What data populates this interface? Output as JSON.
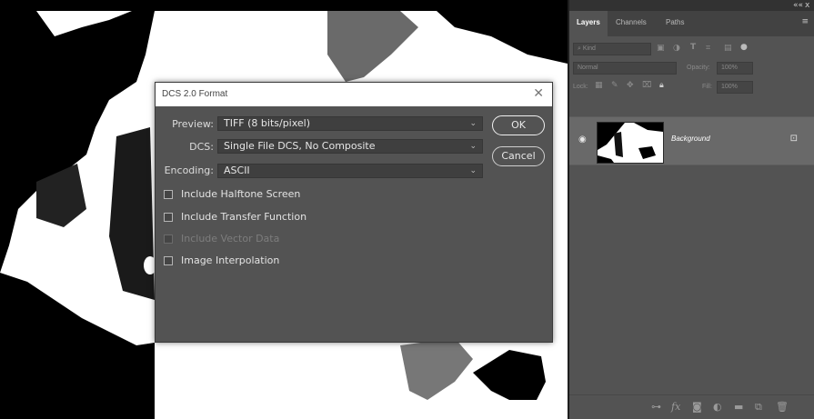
{
  "panel": {
    "top_controls": {
      "collapse": "««",
      "close": "x"
    },
    "tabs": [
      {
        "label": "Layers"
      },
      {
        "label": "Channels"
      },
      {
        "label": "Paths"
      }
    ],
    "menu_icon": "panel-menu-icon",
    "kind_filter": {
      "value": "Kind"
    },
    "blend_mode": {
      "value": "Normal"
    },
    "opacity": {
      "label": "Opacity:",
      "value": "100%"
    },
    "lock": {
      "label": "Lock:"
    },
    "fill": {
      "label": "Fill:",
      "value": "100%"
    },
    "layer": {
      "name": "Background",
      "visible_icon": "eye-icon",
      "lock_icon": "lock-icon"
    },
    "bottom_icons": [
      "link-icon",
      "fx-icon",
      "mask-icon",
      "adjustment-icon",
      "folder-icon",
      "new-layer-icon",
      "trash-icon"
    ]
  },
  "dialog": {
    "title": "DCS 2.0 Format",
    "preview": {
      "label": "Preview:",
      "value": "TIFF  (8 bits/pixel)"
    },
    "dcs": {
      "label": "DCS:",
      "value": "Single File DCS, No Composite"
    },
    "encoding": {
      "label": "Encoding:",
      "value": "ASCII"
    },
    "checkboxes": [
      {
        "label": "Include Halftone Screen",
        "checked": false,
        "enabled": true
      },
      {
        "label": "Include Transfer Function",
        "checked": false,
        "enabled": true
      },
      {
        "label": "Include Vector Data",
        "checked": false,
        "enabled": false
      },
      {
        "label": "Image Interpolation",
        "checked": false,
        "enabled": true
      }
    ],
    "ok_label": "OK",
    "cancel_label": "Cancel"
  }
}
